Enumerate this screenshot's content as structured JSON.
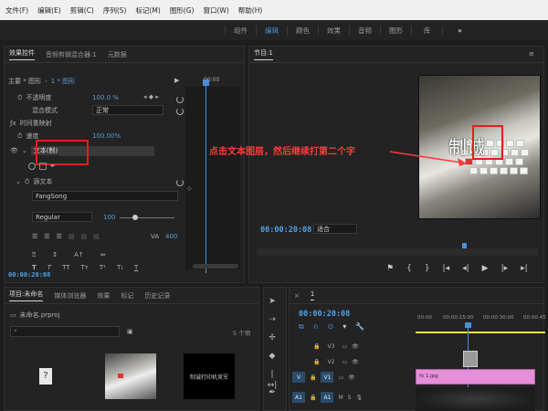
{
  "menubar": {
    "items": [
      "文件(F)",
      "编辑(E)",
      "剪辑(C)",
      "序列(S)",
      "标记(M)",
      "图形(G)",
      "窗口(W)",
      "帮助(H)"
    ]
  },
  "workspace": {
    "tabs": [
      "组件",
      "编辑",
      "颜色",
      "效果",
      "音频",
      "图形",
      "库"
    ],
    "active": "编辑",
    "more": "»"
  },
  "effect_controls": {
    "tabs": [
      "效果控件",
      "音频剪辑混合器:1",
      "元数据"
    ],
    "master_label": "主要 * 图形",
    "clip_label": "1 * 图形",
    "timecode_head": "00:00",
    "opacity_label": "不透明度",
    "opacity_value": "100.0 %",
    "blend_label": "混合模式",
    "blend_value": "正常",
    "time_remap_label": "时间重映射",
    "speed_label": "速度",
    "speed_value": "100.00%",
    "text_layer_label": "文本(制)",
    "source_text_label": "源文本",
    "font_value": "FangSong",
    "style_value": "Regular",
    "size_value": "100",
    "tracking_value": "400",
    "bottom_timecode": "00:00:20:08"
  },
  "program": {
    "title": "节目:1",
    "timecode": "00:00:20:08",
    "fit_value": "适合",
    "overlay_text": "制诚"
  },
  "annotation": {
    "text": "点击文本图层，然后继续打第二个字"
  },
  "project": {
    "tabs": [
      "项目:未命名",
      "媒体浏览器",
      "效果",
      "标记",
      "历史记录"
    ],
    "project_file": "未命名.prproj",
    "item_count": "5 个项",
    "thumb_text": "制诚打印机竞军"
  },
  "timeline": {
    "title": "1",
    "timecode": "00:00:20:08",
    "ruler": [
      "00:00",
      "00:00:15:00",
      "00:00:30:00",
      "00:00:45"
    ],
    "tracks": [
      {
        "name": "V3",
        "label": ""
      },
      {
        "name": "V2",
        "label": ""
      },
      {
        "name": "V1",
        "label": "V"
      },
      {
        "name": "A1",
        "label": "A1"
      }
    ],
    "clip_label": "fx 1.jpg"
  },
  "colors": {
    "accent_blue": "#4a90d9",
    "annotation_red": "#ff3b3b",
    "clip_pink": "#e48fd8"
  }
}
